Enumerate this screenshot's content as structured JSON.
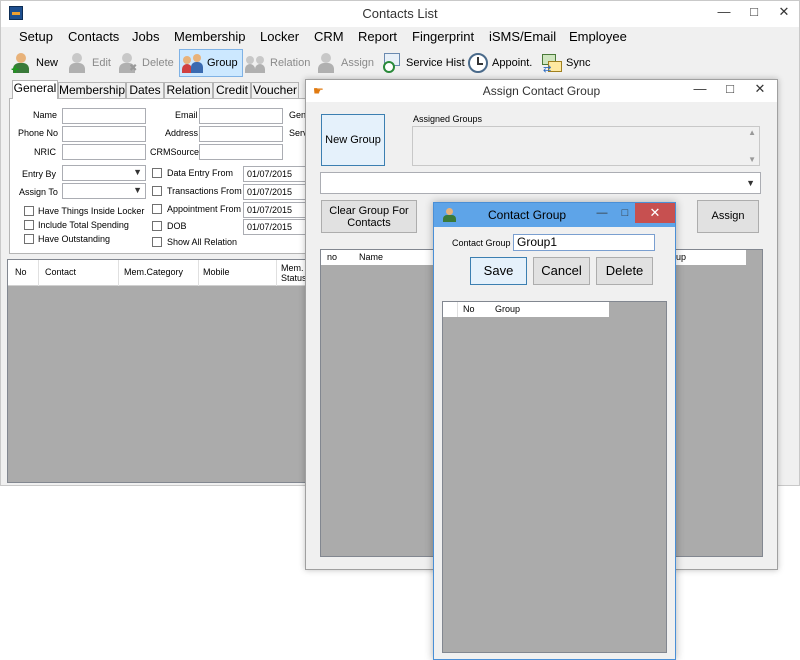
{
  "main": {
    "title": "Contacts List",
    "menu": [
      "Setup",
      "Contacts",
      "Jobs",
      "Membership",
      "Locker",
      "CRM",
      "Report",
      "Fingerprint",
      "iSMS/Email",
      "Employee"
    ],
    "toolbar": {
      "new": "New",
      "edit": "Edit",
      "delete": "Delete",
      "group": "Group",
      "relation": "Relation",
      "assign": "Assign",
      "service_hist": "Service Hist",
      "appoint": "Appoint.",
      "sync": "Sync"
    },
    "tabs": [
      "General",
      "Membership",
      "Dates",
      "Relation",
      "Credit",
      "Voucher"
    ],
    "filters": {
      "name": "Name",
      "phone_no": "Phone No",
      "nric": "NRIC",
      "entry_by": "Entry By",
      "assign_to": "Assign To",
      "email": "Email",
      "address": "Address",
      "crm_source": "CRMSource",
      "gen_trunc": "Gen",
      "serv_trunc": "Serv",
      "chk_locker": "Have Things Inside Locker",
      "chk_spending": "Include Total Spending",
      "chk_outstanding": "Have Outstanding",
      "chk_data_entry": "Data Entry From",
      "chk_transactions": "Transactions From",
      "chk_appointment": "Appointment From",
      "chk_dob": "DOB",
      "chk_show_all": "Show All Relation",
      "date_data_entry": "01/07/2015",
      "date_transactions": "01/07/2015",
      "date_appointment": "01/07/2015",
      "date_dob": "01/07/2015"
    },
    "grid_headers": {
      "no": "No",
      "contact": "Contact",
      "mem_category": "Mem.Category",
      "mobile": "Mobile",
      "mem_status_1": "Mem.",
      "mem_status_2": "Status"
    }
  },
  "assign": {
    "title": "Assign Contact Group",
    "new_group": "New Group",
    "assigned_groups": "Assigned Groups",
    "clear_group_1": "Clear Group For",
    "clear_group_2": "Contacts",
    "assign_button": "Assign",
    "grid_no": "no",
    "grid_name": "Name",
    "grid_group_trunc": "up"
  },
  "contact_group": {
    "title": "Contact Group",
    "label": "Contact Group",
    "value": "Group1",
    "save": "Save",
    "cancel": "Cancel",
    "delete": "Delete",
    "grid_no": "No",
    "grid_group": "Group"
  }
}
